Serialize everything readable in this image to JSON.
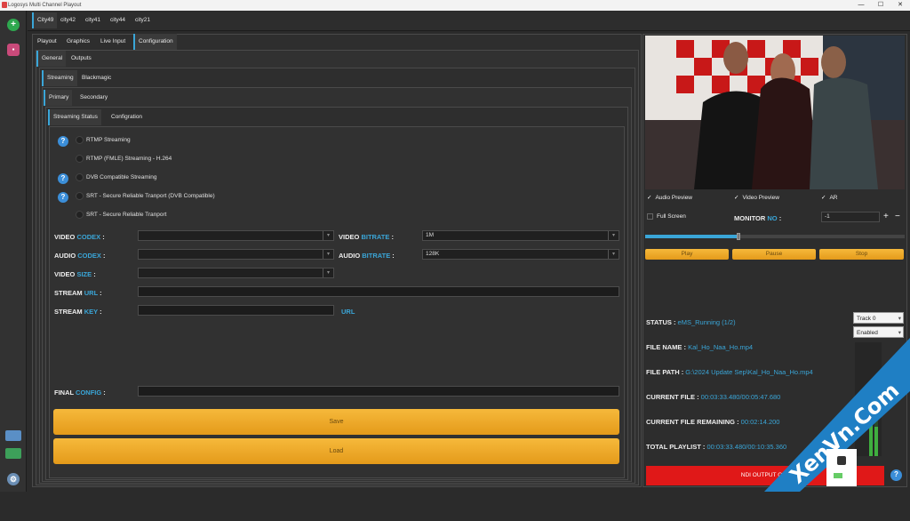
{
  "window": {
    "title": "Logosys Multi Channel Playout",
    "controls": [
      "—",
      "☐",
      "✕"
    ]
  },
  "city_tabs": [
    "City49",
    "city42",
    "city41",
    "city44",
    "city21"
  ],
  "main_tabs": [
    "Playout",
    "Graphics",
    "Live Input",
    "Configuration"
  ],
  "config_tabs": [
    "General",
    "Outputs"
  ],
  "output_tabs": [
    "Streaming",
    "Blackmagic"
  ],
  "stream_tabs": [
    "Primary",
    "Secondary"
  ],
  "status_tabs": [
    "Streaming Status",
    "Configration"
  ],
  "streaming_options": [
    "RTMP Streaming",
    "RTMP (FMLE) Streaming - H.264",
    "DVB Compatible Streaming",
    "SRT - Secure Reliable Tranport (DVB Compatible)",
    "SRT - Secure Reliable Tranport"
  ],
  "form": {
    "video_codex": {
      "w1": "VIDEO",
      "w2": "CODEX",
      "colon": " :"
    },
    "audio_codex": {
      "w1": "AUDIO",
      "w2": "CODEX",
      "colon": " :"
    },
    "video_size": {
      "w1": "VIDEO",
      "w2": "SIZE",
      "colon": " :"
    },
    "stream_url": {
      "w1": "STREAM",
      "w2": "URL",
      "colon": " :"
    },
    "stream_key": {
      "w1": "STREAM",
      "w2": "KEY",
      "colon": " :"
    },
    "video_bitrate": {
      "w1": "VIDEO",
      "w2": "BITRATE",
      "colon": " :",
      "value": "1M"
    },
    "audio_bitrate": {
      "w1": "AUDIO",
      "w2": "BITRATE",
      "colon": " :",
      "value": "128K"
    },
    "url_link": "URL",
    "final_config": {
      "w1": "FINAL",
      "w2": "CONFIG",
      "colon": " :"
    },
    "save": "Save",
    "load": "Load"
  },
  "preview": {
    "audio_preview": "Audio Preview",
    "video_preview": "Video Preview",
    "ar": "AR",
    "full_screen": "Full Screen",
    "monitor_label": "MONITOR",
    "monitor_no": "NO",
    "monitor_colon": " :",
    "monitor_value": "-1",
    "plus": "+",
    "minus": "−",
    "progress": 0.36,
    "play": "Play",
    "pause": "Pause",
    "stop": "Stop"
  },
  "status": {
    "status_label": "STATUS :",
    "status_value": " eMS_Running (1/2)",
    "file_name_label": "FILE NAME :",
    "file_name_value": " Kal_Ho_Naa_Ho.mp4",
    "file_path_label": "FILE PATH :",
    "file_path_value": " G:\\2024 Update Sep\\Kal_Ho_Naa_Ho.mp4",
    "current_file_label": "CURRENT FILE :",
    "current_file_value": " 00:03:33.480/00:05:47.680",
    "remaining_label": "CURRENT FILE REMAINING :",
    "remaining_value": " 00:02:14.200",
    "playlist_label": "TOTAL PLAYLIST :",
    "playlist_value": " 00:03:33.480/00:10:35.360"
  },
  "track_select": "Track 0",
  "enabled_select": "Enabled",
  "ndi_button": "NDI OUTPUT OFF",
  "watermark": "XenVn.Com",
  "colors": {
    "accent": "#3aa6d8",
    "orange": "#f0a92a",
    "red": "#e01818"
  }
}
